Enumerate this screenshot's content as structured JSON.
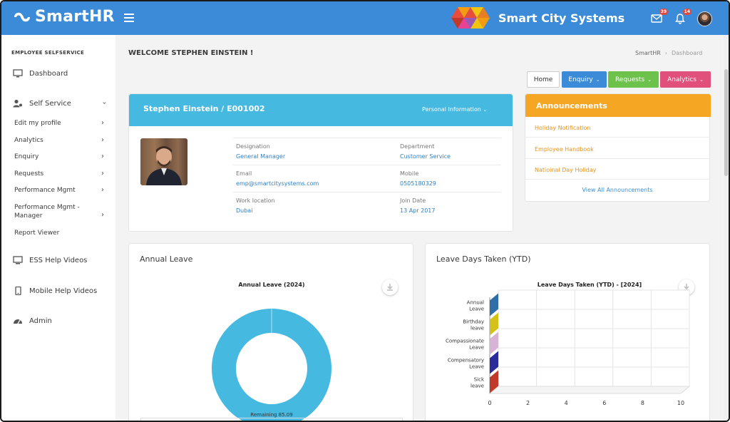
{
  "topbar": {
    "app_name": "SmartHR",
    "company_name": "Smart City Systems",
    "mail_badge": "39",
    "bell_badge": "14",
    "colors": {
      "bar": "#3b8bd8"
    }
  },
  "sidebar": {
    "section_title": "EMPLOYEE SELFSERVICE",
    "dashboard": "Dashboard",
    "self_service": "Self Service",
    "sub_items": [
      {
        "label": "Edit my profile"
      },
      {
        "label": "Analytics"
      },
      {
        "label": "Enquiry"
      },
      {
        "label": "Requests"
      },
      {
        "label": "Performance Mgmt"
      },
      {
        "label": "Performance Mgmt -\nManager"
      },
      {
        "label": "Report Viewer"
      }
    ],
    "ess_videos": "ESS Help Videos",
    "mobile_videos": "Mobile Help Videos",
    "admin": "Admin"
  },
  "header": {
    "welcome": "WELCOME STEPHEN EINSTEIN !",
    "breadcrumb_root": "SmartHR",
    "breadcrumb_current": "Dashboard"
  },
  "actions": {
    "home": "Home",
    "enquiry": "Enquiry",
    "requests": "Requests",
    "analytics": "Analytics",
    "colors": {
      "enquiry": "#3b8bd8",
      "requests": "#6cc24a",
      "analytics": "#e0507a"
    }
  },
  "profile": {
    "title": "Stephen Einstein / E001002",
    "menu": "Personal Information",
    "fields": {
      "designation_label": "Designation",
      "designation": "General Manager",
      "department_label": "Department",
      "department": "Customer Service",
      "email_label": "Email",
      "email": "emp@smartcitysystems.com",
      "mobile_label": "Mobile",
      "mobile": "0505180329",
      "location_label": "Work location",
      "location": "Dubai",
      "join_label": "Join Date",
      "join_date": "13 Apr 2017"
    }
  },
  "announcements": {
    "title": "Announcements",
    "items": [
      "Holiday Notification",
      "Employee Handbook",
      "Natioinal Day Holiday"
    ],
    "view_all": "View All Announcements"
  },
  "annual_leave": {
    "card_title": "Annual Leave",
    "chart_title": "Annual Leave (2024)",
    "slice_label": "Remaining 85.09"
  },
  "leave_taken": {
    "card_title": "Leave Days Taken (YTD)",
    "chart_title": "Leave Days Taken (YTD) - [2024]"
  },
  "chart_data": [
    {
      "type": "pie",
      "title": "Annual Leave (2024)",
      "categories": [
        "Remaining"
      ],
      "values": [
        85.09
      ],
      "colors": [
        "#45b9e0"
      ]
    },
    {
      "type": "bar",
      "title": "Leave Days Taken (YTD) - [2024]",
      "categories": [
        "Annual\nLeave",
        "Birthday\nleave",
        "Compassionate\nLeave",
        "Compensatory\nLeave",
        "Sick\nleave"
      ],
      "values": [
        0,
        0,
        0,
        0,
        0
      ],
      "colors": [
        "#2f6fa8",
        "#d4c21a",
        "#d9b3d6",
        "#2b2c9c",
        "#c0392b"
      ],
      "xlim": [
        0,
        10
      ],
      "xticks": [
        "0",
        "2",
        "4",
        "6",
        "8",
        "10"
      ],
      "grid": true
    }
  ]
}
